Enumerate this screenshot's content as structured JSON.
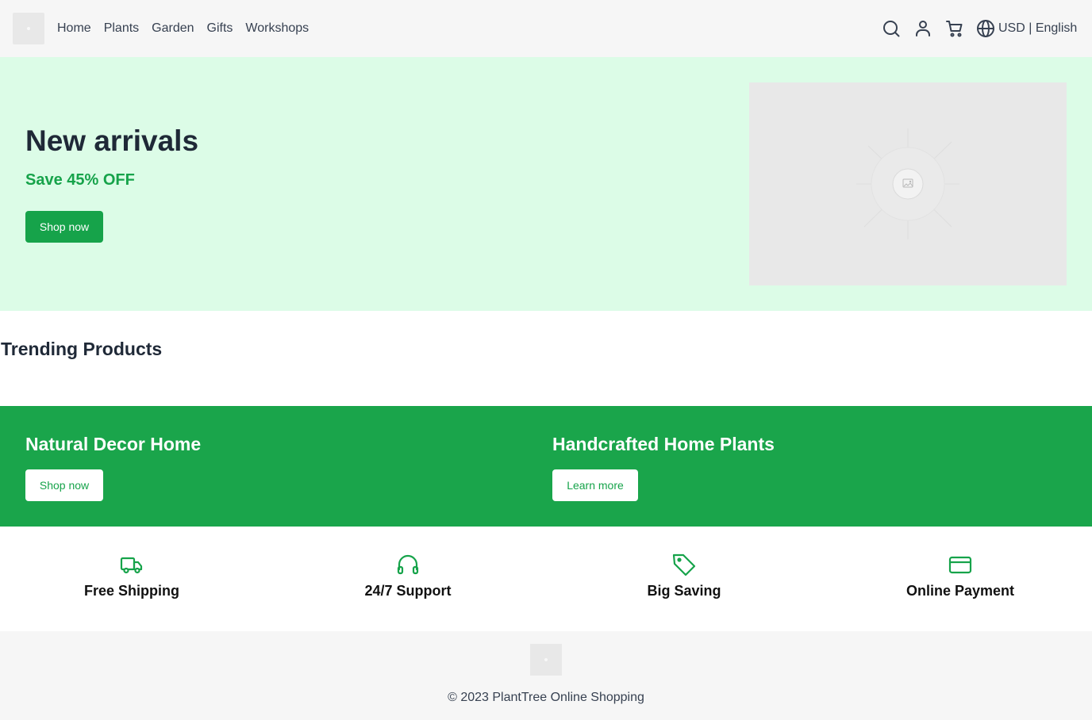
{
  "header": {
    "nav": [
      "Home",
      "Plants",
      "Garden",
      "Gifts",
      "Workshops"
    ],
    "icons": [
      "search-icon",
      "user-icon",
      "cart-icon",
      "globe-icon"
    ],
    "currency": "USD",
    "separator": " | ",
    "language": "English"
  },
  "hero": {
    "title": "New arrivals",
    "subtitle": "Save 45% OFF",
    "button": "Shop now"
  },
  "trending": {
    "title": "Trending Products"
  },
  "promos": [
    {
      "title": "Natural Decor Home",
      "button": "Shop now"
    },
    {
      "title": "Handcrafted Home Plants",
      "button": "Learn more"
    }
  ],
  "features": [
    {
      "icon": "truck-icon",
      "label": "Free Shipping"
    },
    {
      "icon": "headphones-icon",
      "label": "24/7 Support"
    },
    {
      "icon": "tag-icon",
      "label": "Big Saving"
    },
    {
      "icon": "credit-card-icon",
      "label": "Online Payment"
    }
  ],
  "footer": {
    "copyright": "© 2023 PlantTree Online Shopping"
  },
  "colors": {
    "brand_green": "#16a34a",
    "hero_bg": "#dcfce7",
    "promo_bg": "#1aa54b",
    "header_bg": "#f6f6f6"
  }
}
